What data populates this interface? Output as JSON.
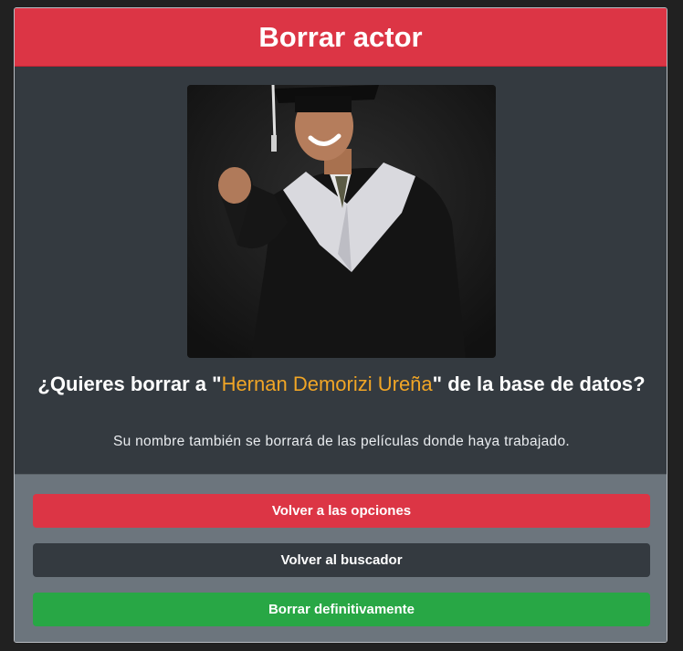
{
  "header": {
    "title": "Borrar actor"
  },
  "body": {
    "photo_alt": "Hernan Demorizi Ureña",
    "question_prefix": "¿Quieres borrar a \"",
    "actor_name": "Hernan Demorizi Ureña",
    "question_suffix": "\" de la base de datos?",
    "subtext": "Su nombre también se borrará de las películas donde haya trabajado."
  },
  "footer": {
    "back_options_label": "Volver a las opciones",
    "back_search_label": "Volver al buscador",
    "delete_label": "Borrar definitivamente"
  },
  "colors": {
    "header_bg": "#dc3545",
    "body_bg": "#343a40",
    "footer_bg": "#6c757d",
    "name_accent": "#f0a526",
    "danger": "#dc3545",
    "dark": "#343a40",
    "success": "#28a745"
  }
}
